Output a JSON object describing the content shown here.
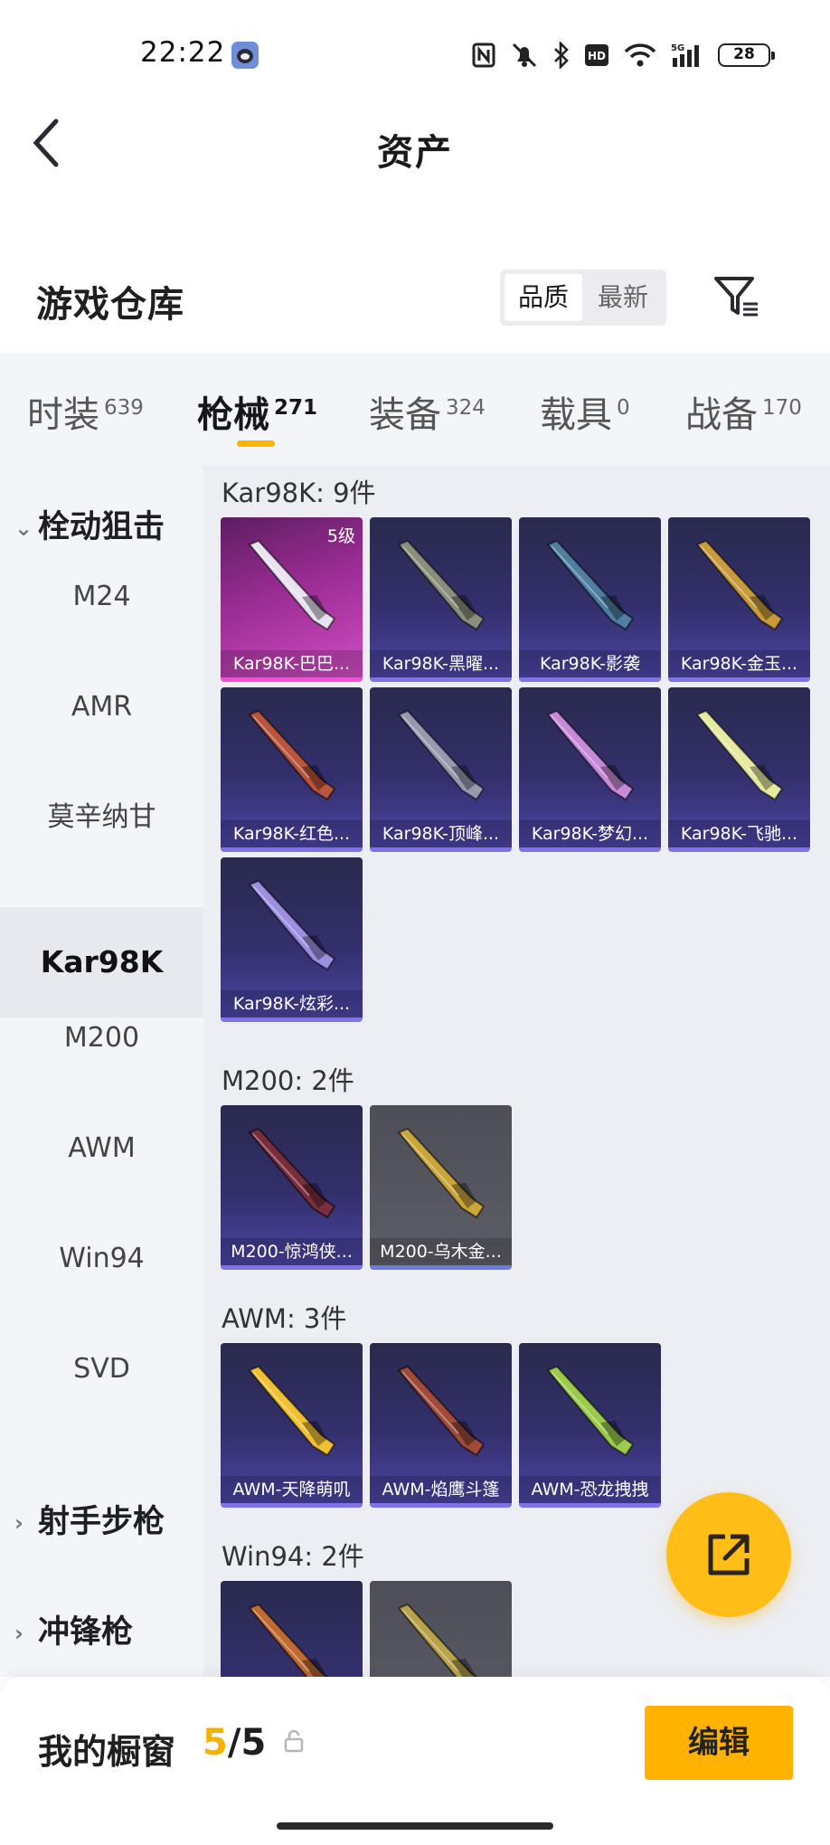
{
  "status_bar": {
    "time": "22:22",
    "battery": "28"
  },
  "header": {
    "title": "资产"
  },
  "warehouse": {
    "title": "游戏仓库",
    "sort_options": [
      "品质",
      "最新"
    ]
  },
  "tabs": [
    {
      "label": "时装",
      "count": "639"
    },
    {
      "label": "枪械",
      "count": "271",
      "active": true
    },
    {
      "label": "装备",
      "count": "324"
    },
    {
      "label": "载具",
      "count": "0"
    },
    {
      "label": "战备",
      "count": "170"
    }
  ],
  "sidebar": {
    "category1": "栓动狙击",
    "items": [
      "M24",
      "AMR",
      "莫辛纳甘",
      "Kar98K",
      "M200",
      "AWM",
      "Win94",
      "SVD"
    ],
    "active_item": "Kar98K",
    "category2": "射手步枪",
    "category3": "冲锋枪"
  },
  "groups": [
    {
      "title": "Kar98K: 9件",
      "items": [
        {
          "name": "Kar98K-巴巴...",
          "level": "5级",
          "style": "legend",
          "color": "#e9e2f0"
        },
        {
          "name": "Kar98K-黑曜...",
          "style": "epic",
          "color": "#8a8e7a"
        },
        {
          "name": "Kar98K-影袭",
          "style": "epic",
          "color": "#4f7ea0"
        },
        {
          "name": "Kar98K-金玉...",
          "style": "epic",
          "color": "#c89a3c"
        },
        {
          "name": "Kar98K-红色...",
          "style": "epic",
          "color": "#b9553a"
        },
        {
          "name": "Kar98K-顶峰...",
          "style": "epic",
          "color": "#9a98b0"
        },
        {
          "name": "Kar98K-梦幻...",
          "style": "epic",
          "color": "#c78ad8"
        },
        {
          "name": "Kar98K-飞驰...",
          "style": "epic",
          "color": "#e6e9a0"
        },
        {
          "name": "Kar98K-炫彩...",
          "style": "epic",
          "color": "#9c8ee0"
        }
      ]
    },
    {
      "title": "M200: 2件",
      "items": [
        {
          "name": "M200-惊鸿侠...",
          "style": "epic",
          "color": "#7a2d3c"
        },
        {
          "name": "M200-乌木金...",
          "style": "gray",
          "color": "#c9a53a"
        }
      ]
    },
    {
      "title": "AWM: 3件",
      "items": [
        {
          "name": "AWM-天降萌叽",
          "style": "epic",
          "color": "#f0c030"
        },
        {
          "name": "AWM-焰鹰斗篷",
          "style": "epic",
          "color": "#a04a3a"
        },
        {
          "name": "AWM-恐龙拽拽",
          "style": "epic",
          "color": "#9acb4a"
        }
      ]
    },
    {
      "title": "Win94: 2件",
      "items": [
        {
          "name": "",
          "style": "epic",
          "color": "#c06a30"
        },
        {
          "name": "",
          "style": "gray",
          "color": "#b8a24a"
        }
      ]
    }
  ],
  "showcase": {
    "label": "我的橱窗",
    "current": "5",
    "total": "/5"
  },
  "edit_button": "编辑"
}
